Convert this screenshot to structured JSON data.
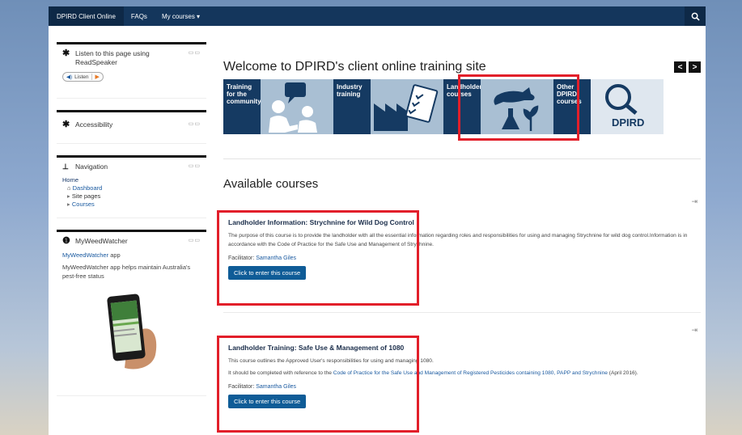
{
  "topbar": {
    "brand": "DPIRD Client Online",
    "faqs": "FAQs",
    "my_courses": "My courses ▾"
  },
  "sidebar": {
    "readspeaker": {
      "title": "Listen to this page using ReadSpeaker",
      "listen": "Listen"
    },
    "accessibility": {
      "title": "Accessibility"
    },
    "navigation": {
      "title": "Navigation",
      "home": "Home",
      "dashboard": "Dashboard",
      "site_pages": "Site pages",
      "courses": "Courses"
    },
    "myweedwatcher": {
      "title": "MyWeedWatcher",
      "link": "MyWeedWatcher",
      "link_suffix": " app",
      "text": "MyWeedWatcher app helps maintain Australia's pest-free status"
    },
    "block_controls": "▭▭"
  },
  "main": {
    "welcome_title": "Welcome to DPIRD's client online training site",
    "prev": "<",
    "next": ">",
    "tiles": [
      {
        "label": "Training for the community"
      },
      {
        "label": "Industry training"
      },
      {
        "label": "Landholder courses"
      },
      {
        "label": "Other DPIRD courses",
        "logo_text": "DPIRD"
      }
    ],
    "available_title": "Available courses",
    "courses": [
      {
        "title": "Landholder Information: Strychnine for Wild Dog Control",
        "desc": "The purpose of this course is to provide the landholder with all the essential information regarding roles and responsibilities for using and managing Strychnine for wild dog control.Information is in accordance with the Code of Practice for the Safe Use and Management of Strychnine.",
        "facilitator_label": "Facilitator: ",
        "facilitator": "Samantha Giles",
        "button": "Click to enter this course"
      },
      {
        "title": "Landholder Training: Safe Use & Management of 1080",
        "desc1": "This course outlines the Approved User's responsibilities for using and managing 1080.",
        "desc2_pre": "It should be completed with reference to the ",
        "desc2_link": "Code of Practice for the Safe Use and Management of Registered Pesticides containing 1080, PAPP and Strychnine",
        "desc2_post": " (April 2016).",
        "facilitator_label": "Facilitator: ",
        "facilitator": "Samantha Giles",
        "button": "Click to enter this course"
      }
    ]
  },
  "colors": {
    "navy": "#14365c",
    "highlight": "#e21f2a",
    "button": "#0f5c97"
  }
}
